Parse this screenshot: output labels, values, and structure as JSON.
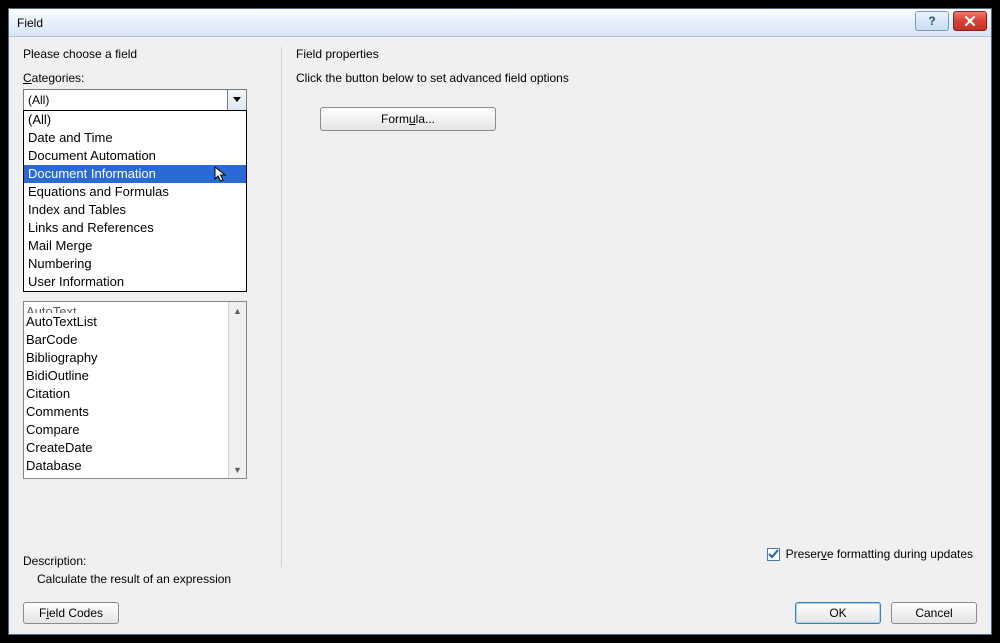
{
  "window": {
    "title": "Field"
  },
  "left_panel": {
    "heading": "Please choose a field",
    "categories_label_prefix": "C",
    "categories_label_rest": "ategories:",
    "combo_value": "(All)",
    "dropdown_items": [
      "(All)",
      "Date and Time",
      "Document Automation",
      "Document Information",
      "Equations and Formulas",
      "Index and Tables",
      "Links and References",
      "Mail Merge",
      "Numbering",
      "User Information"
    ],
    "selected_index": 3,
    "list_partial_first": "AutoText",
    "list_items": [
      "AutoTextList",
      "BarCode",
      "Bibliography",
      "BidiOutline",
      "Citation",
      "Comments",
      "Compare",
      "CreateDate",
      "Database"
    ]
  },
  "right_panel": {
    "heading": "Field properties",
    "instruction": "Click the button below to set advanced field options",
    "formula_prefix": "Form",
    "formula_ul": "u",
    "formula_rest": "la...",
    "preserve_prefix": "Preser",
    "preserve_ul": "v",
    "preserve_rest": "e formatting during updates"
  },
  "description": {
    "label": "Description:",
    "text": "Calculate the result of an expression"
  },
  "footer": {
    "field_codes_prefix": "F",
    "field_codes_ul": "i",
    "field_codes_rest": "eld Codes",
    "ok": "OK",
    "cancel": "Cancel"
  }
}
